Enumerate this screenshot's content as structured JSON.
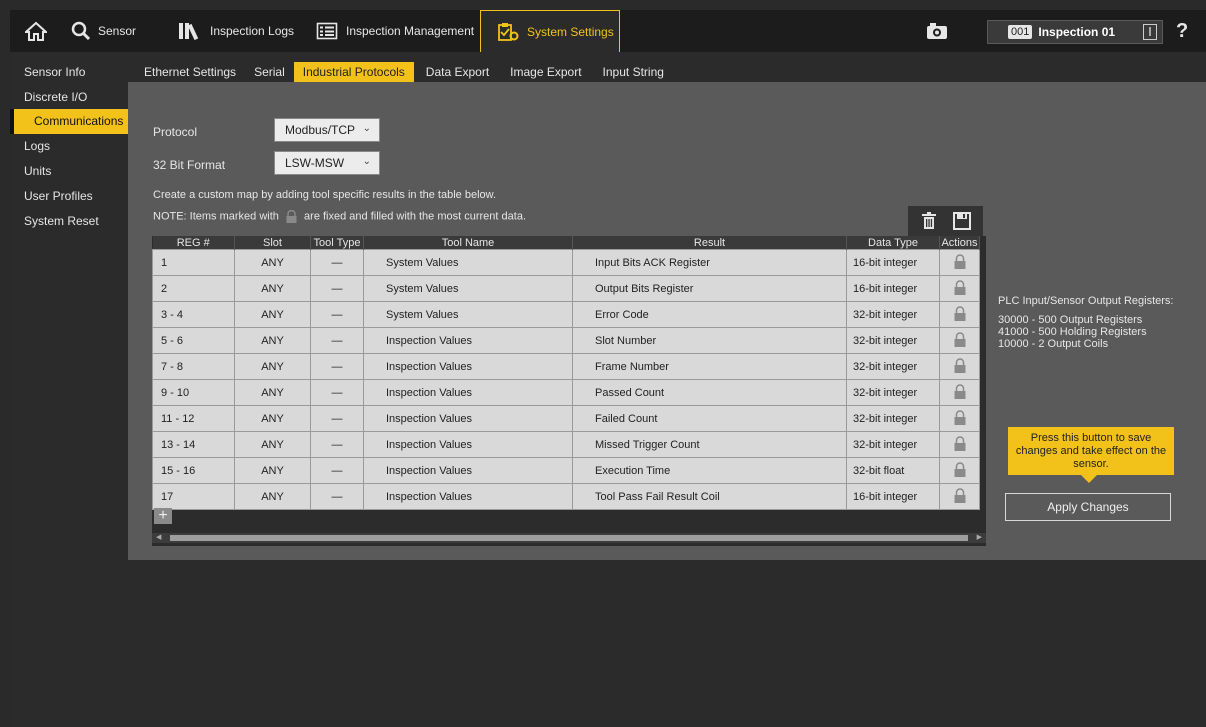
{
  "topbar": {
    "sensor_label": "Sensor",
    "inspection_logs_label": "Inspection Logs",
    "inspection_management_label": "Inspection Management",
    "system_settings_label": "System Settings",
    "inspection_number": "001",
    "inspection_name": "Inspection 01",
    "help_label": "?"
  },
  "sidebar": {
    "items": [
      {
        "label": "Sensor Info"
      },
      {
        "label": "Discrete I/O"
      },
      {
        "label": "Communications"
      },
      {
        "label": "Logs"
      },
      {
        "label": "Units"
      },
      {
        "label": "User Profiles"
      },
      {
        "label": "System Reset"
      }
    ],
    "active_index": 2
  },
  "subtabs": {
    "items": [
      {
        "label": "Ethernet Settings"
      },
      {
        "label": "Serial"
      },
      {
        "label": "Industrial Protocols"
      },
      {
        "label": "Data Export"
      },
      {
        "label": "Image Export"
      },
      {
        "label": "Input String"
      }
    ],
    "active_index": 2
  },
  "form": {
    "protocol_label": "Protocol",
    "protocol_value": "Modbus/TCP",
    "format_label": "32 Bit Format",
    "format_value": "LSW-MSW"
  },
  "notes": {
    "line1": "Create a custom map by adding tool specific results in the table below.",
    "line2_prefix": "NOTE: Items marked with",
    "line2_suffix": "are fixed and filled with the most current data."
  },
  "table": {
    "headers": [
      "REG #",
      "Slot",
      "Tool Type",
      "Tool Name",
      "Result",
      "Data Type",
      "Actions"
    ],
    "rows": [
      {
        "reg": "1",
        "slot": "ANY",
        "tool_type": "—",
        "tool_name": "System Values",
        "result": "Input Bits ACK Register",
        "data_type": "16-bit integer"
      },
      {
        "reg": "2",
        "slot": "ANY",
        "tool_type": "—",
        "tool_name": "System Values",
        "result": "Output Bits Register",
        "data_type": "16-bit integer"
      },
      {
        "reg": "3 - 4",
        "slot": "ANY",
        "tool_type": "—",
        "tool_name": "System Values",
        "result": "Error Code",
        "data_type": "32-bit integer"
      },
      {
        "reg": "5 - 6",
        "slot": "ANY",
        "tool_type": "—",
        "tool_name": "Inspection Values",
        "result": "Slot Number",
        "data_type": "32-bit integer"
      },
      {
        "reg": "7 - 8",
        "slot": "ANY",
        "tool_type": "—",
        "tool_name": "Inspection Values",
        "result": "Frame Number",
        "data_type": "32-bit integer"
      },
      {
        "reg": "9 - 10",
        "slot": "ANY",
        "tool_type": "—",
        "tool_name": "Inspection Values",
        "result": "Passed Count",
        "data_type": "32-bit integer"
      },
      {
        "reg": "11 - 12",
        "slot": "ANY",
        "tool_type": "—",
        "tool_name": "Inspection Values",
        "result": "Failed Count",
        "data_type": "32-bit integer"
      },
      {
        "reg": "13 - 14",
        "slot": "ANY",
        "tool_type": "—",
        "tool_name": "Inspection Values",
        "result": "Missed Trigger Count",
        "data_type": "32-bit integer"
      },
      {
        "reg": "15 - 16",
        "slot": "ANY",
        "tool_type": "—",
        "tool_name": "Inspection Values",
        "result": "Execution Time",
        "data_type": "32-bit float"
      },
      {
        "reg": "17",
        "slot": "ANY",
        "tool_type": "—",
        "tool_name": "Inspection Values",
        "result": "Tool Pass Fail Result Coil",
        "data_type": "16-bit integer"
      }
    ]
  },
  "plc_info": {
    "title": "PLC Input/Sensor Output Registers:",
    "lines": [
      "30000 - 500 Output Registers",
      "41000 - 500 Holding Registers",
      "10000 - 2 Output Coils"
    ]
  },
  "tooltip": "Press this button to save changes and take effect on the sensor.",
  "apply_label": "Apply Changes",
  "add_label": "+",
  "colors": {
    "accent": "#f2c21a",
    "panel": "#5a5a5a",
    "cell": "#d9d9d9"
  }
}
